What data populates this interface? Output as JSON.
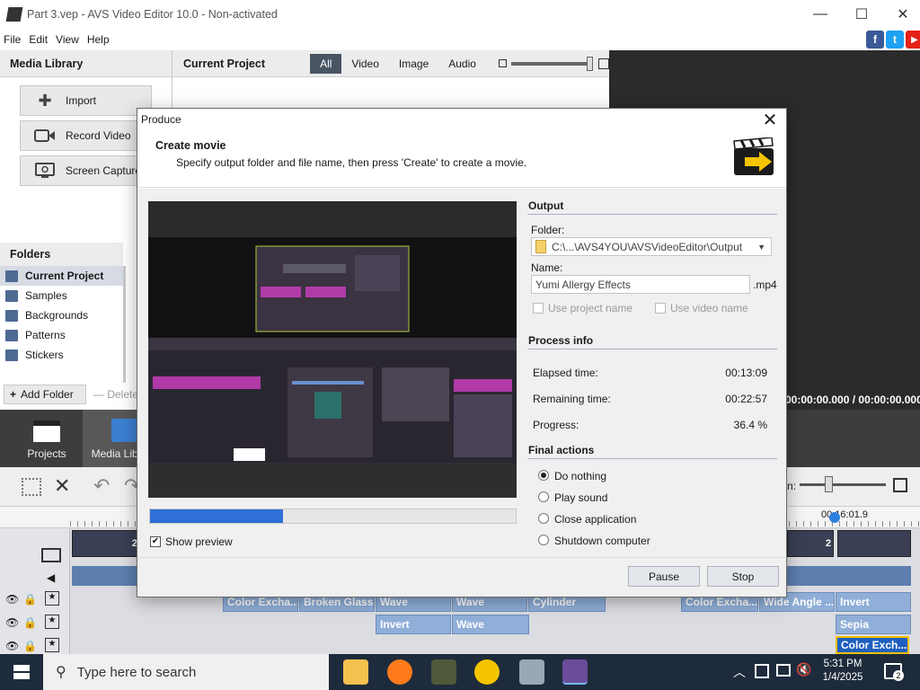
{
  "window": {
    "title": "Part 3.vep - AVS Video Editor 10.0 - Non-activated",
    "minimize_icon": "minimize-icon",
    "maximize_icon": "maximize-icon",
    "close_icon": "close-icon"
  },
  "menu": [
    "File",
    "Edit",
    "View",
    "Help"
  ],
  "social": {
    "facebook": "f",
    "twitter": "t",
    "youtube": "▶"
  },
  "media_library": {
    "title": "Media Library",
    "buttons": [
      {
        "label": "Import"
      },
      {
        "label": "Record Video"
      },
      {
        "label": "Screen Capture"
      }
    ],
    "folders_title": "Folders",
    "folders": [
      "Current Project",
      "Samples",
      "Backgrounds",
      "Patterns",
      "Stickers"
    ],
    "add_folder": "Add Folder",
    "delete": "Delete"
  },
  "current_project": {
    "title": "Current Project",
    "tabs": [
      "All",
      "Video",
      "Image",
      "Audio"
    ],
    "active_tab": "All"
  },
  "nav": {
    "projects": "Projects",
    "media_library": "Media Library"
  },
  "preview": {
    "time": "00:00:00.000 / 00:00:00.000"
  },
  "timeline": {
    "zoom_label": "n:",
    "timecode": "00:16:01.9",
    "thumb_label_a": "2",
    "thumb_label_b": "2",
    "effects_row1": [
      "Color Excha...",
      "Broken Glass",
      "Wave",
      "Wave",
      "Cylinder",
      "Color Excha...",
      "Wide Angle ...",
      "Invert"
    ],
    "effects_row2": [
      "Invert",
      "Wave",
      "Sepia"
    ],
    "effects_row3": [
      "Color Exch..."
    ]
  },
  "dialog": {
    "title": "Produce",
    "heading": "Create movie",
    "subheading": "Specify output folder and file name, then press 'Create' to create a movie.",
    "progress_fraction": 0.364,
    "show_preview_label": "Show preview",
    "show_preview_checked": true,
    "output": {
      "title": "Output",
      "folder_label": "Folder:",
      "folder_value": "C:\\...\\AVS4YOU\\AVSVideoEditor\\Output",
      "name_label": "Name:",
      "name_value": "Yumi Allergy Effects",
      "extension": ".mp4",
      "use_project_name": "Use project name",
      "use_video_name": "Use video name"
    },
    "process_info": {
      "title": "Process info",
      "elapsed_label": "Elapsed time:",
      "elapsed_value": "00:13:09",
      "remaining_label": "Remaining time:",
      "remaining_value": "00:22:57",
      "progress_label": "Progress:",
      "progress_value": "36.4 %"
    },
    "final_actions": {
      "title": "Final actions",
      "options": [
        "Do nothing",
        "Play sound",
        "Close application",
        "Shutdown computer"
      ],
      "selected": "Do nothing"
    },
    "buttons": {
      "pause": "Pause",
      "stop": "Stop"
    }
  },
  "taskbar": {
    "search_placeholder": "Type here to search",
    "time": "5:31 PM",
    "date": "1/4/2025",
    "notifications": "2"
  }
}
